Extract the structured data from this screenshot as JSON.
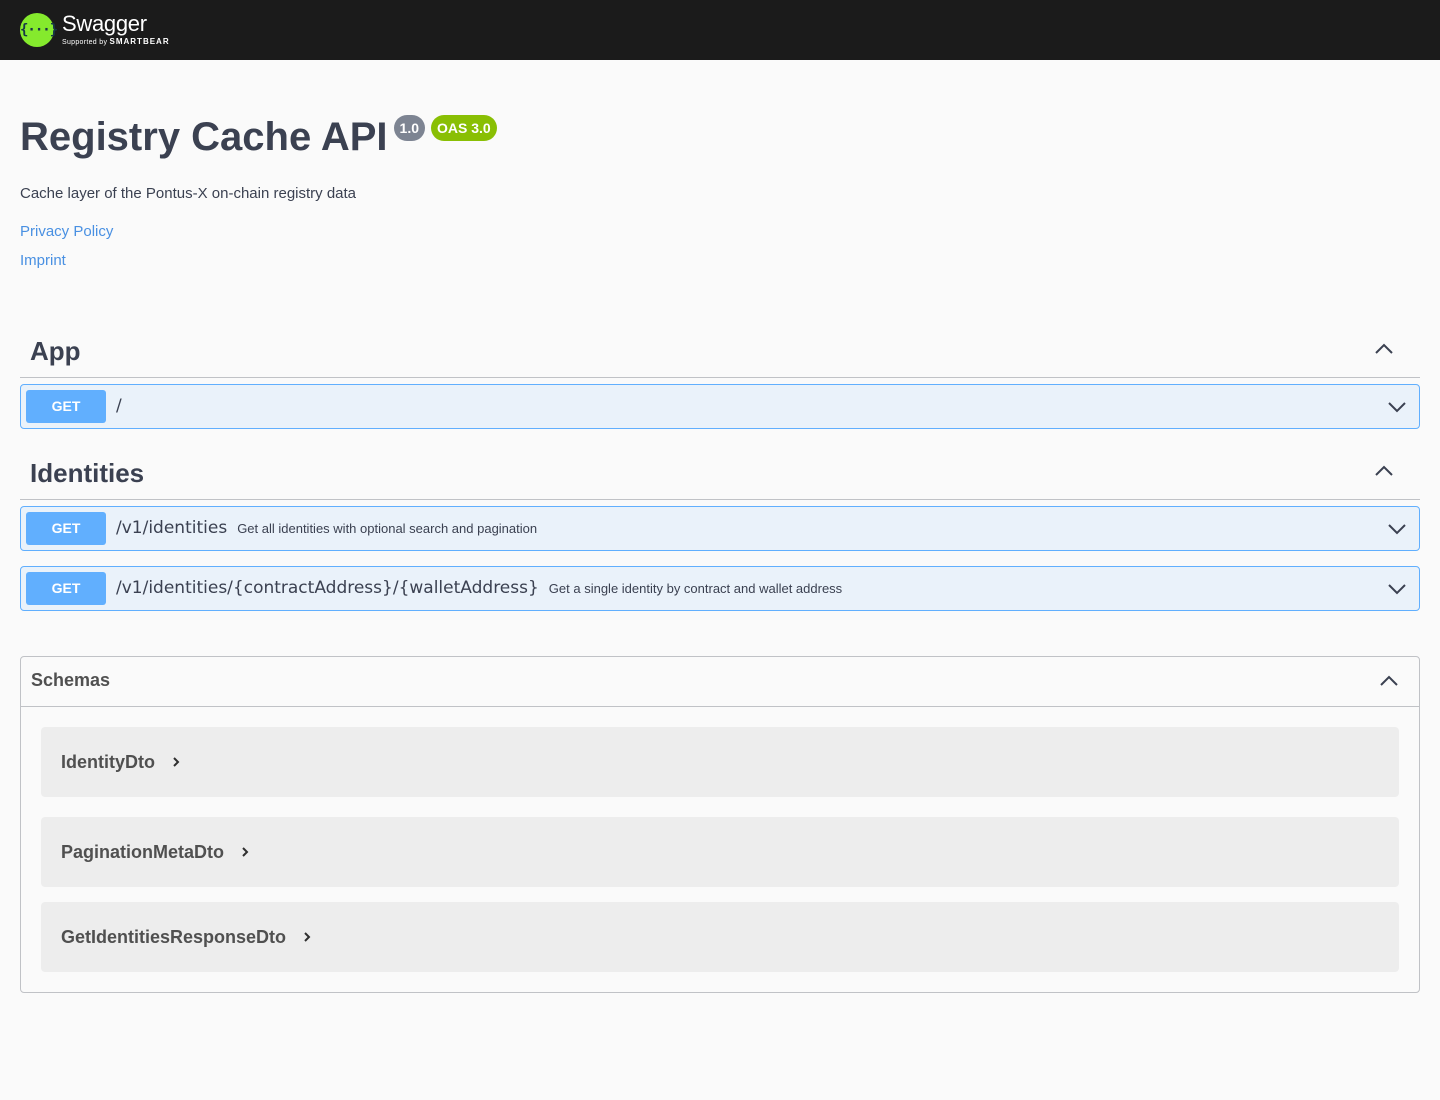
{
  "topbar": {
    "logo_name": "Swagger",
    "logo_sub_prefix": "Supported by",
    "logo_sub_brand": "SMARTBEAR",
    "logo_glyph": "{···}",
    "logo_color": "#85ea2d"
  },
  "info": {
    "title": "Registry Cache API",
    "version": "1.0",
    "oas": "OAS 3.0",
    "description": "Cache layer of the Pontus-X on-chain registry data",
    "links": [
      "Privacy Policy",
      "Imprint"
    ]
  },
  "tags": [
    {
      "name": "App",
      "operations": [
        {
          "method": "GET",
          "path": "/",
          "summary": ""
        }
      ]
    },
    {
      "name": "Identities",
      "operations": [
        {
          "method": "GET",
          "path": "/v1/identities",
          "summary": "Get all identities with optional search and pagination"
        },
        {
          "method": "GET",
          "path": "/v1/identities/{contractAddress}/{walletAddress}",
          "summary": "Get a single identity by contract and wallet address"
        }
      ]
    }
  ],
  "schemas": {
    "title": "Schemas",
    "items": [
      "IdentityDto",
      "PaginationMetaDto",
      "GetIdentitiesResponseDto"
    ]
  },
  "colors": {
    "get": "#61afe",
    "oas_badge": "#89bf04",
    "version_badge": "#7d8492",
    "link": "#4990e2",
    "topbar": "#1b1b1b"
  }
}
